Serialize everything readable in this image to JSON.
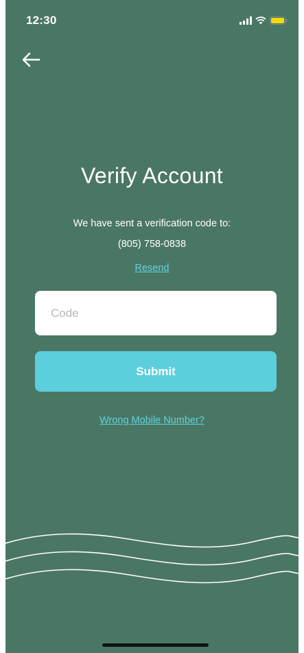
{
  "status_bar": {
    "time": "12:30"
  },
  "header": {
    "back_icon": "arrow-left-icon"
  },
  "main": {
    "title": "Verify Account",
    "message": "We have sent a verification code to:",
    "phone_number": "(805) 758-0838",
    "resend_label": "Resend",
    "code_input": {
      "placeholder": "Code",
      "value": ""
    },
    "submit_label": "Submit",
    "wrong_number_label": "Wrong Mobile Number?"
  },
  "colors": {
    "background": "#4a7764",
    "accent": "#5ccfdc",
    "link": "#5fd2df",
    "battery": "#f5d90a"
  }
}
